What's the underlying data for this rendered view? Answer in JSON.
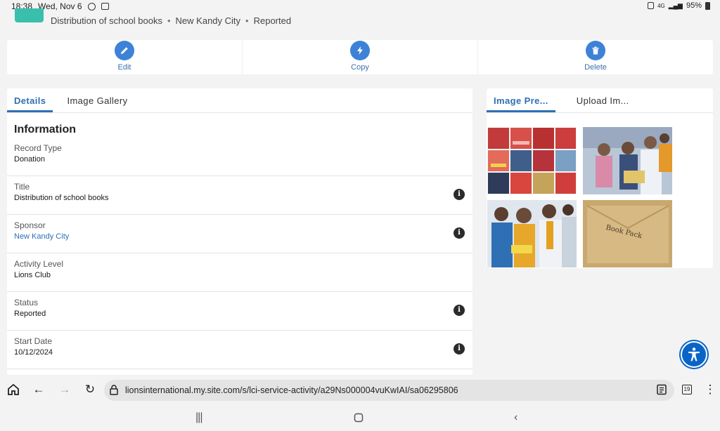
{
  "status_bar": {
    "time": "18:38",
    "date": "Wed, Nov 6",
    "battery": "95%"
  },
  "header": {
    "breadcrumbs": [
      "Distribution of school books",
      "New Kandy City",
      "Reported"
    ]
  },
  "actions": [
    {
      "label": "Edit",
      "icon": "pencil-icon"
    },
    {
      "label": "Copy",
      "icon": "lightning-icon"
    },
    {
      "label": "Delete",
      "icon": "trash-icon"
    }
  ],
  "details": {
    "tabs": [
      "Details",
      "Image Gallery"
    ],
    "active_tab": "Details",
    "section_title": "Information",
    "fields": [
      {
        "label": "Record Type",
        "value": "Donation",
        "help": false,
        "link": false
      },
      {
        "label": "Title",
        "value": "Distribution of school books",
        "help": true,
        "link": false
      },
      {
        "label": "Sponsor",
        "value": "New Kandy City",
        "help": true,
        "link": true
      },
      {
        "label": "Activity Level",
        "value": "Lions Club",
        "help": false,
        "link": false
      },
      {
        "label": "Status",
        "value": "Reported",
        "help": true,
        "link": false
      },
      {
        "label": "Start Date",
        "value": "10/12/2024",
        "help": true,
        "link": false
      }
    ]
  },
  "gallery": {
    "tabs": [
      "Image Pre...",
      "Upload Im..."
    ],
    "active_tab": "Image Pre...",
    "handwriting": "Book Pack"
  },
  "browser": {
    "url": "lionsinternational.my.site.com/s/lci-service-activity/a29Ns000004vuKwIAI/sa06295806",
    "tab_count": "19"
  },
  "colors": {
    "accent": "#3d82d6",
    "brand_badge": "#3bbfad",
    "accessibility": "#0a64c8"
  }
}
